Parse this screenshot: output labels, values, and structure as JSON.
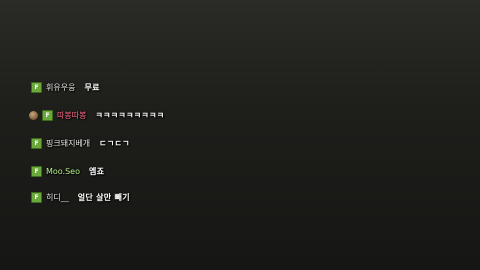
{
  "chat": {
    "messages": [
      {
        "badge": "F",
        "username": "휘유우웅",
        "text": "무료"
      },
      {
        "badge": "F",
        "has_avatar": true,
        "username": "따봉따봉",
        "text": "ㅋㅋㅋㅋㅋㅋㅋㅋㅋ"
      },
      {
        "badge": "F",
        "username": "핑크돼지베개",
        "text": "ㄷㄱㄷㄱ"
      },
      {
        "badge": "F",
        "username": "Moo.Seo",
        "text": "엠죠"
      },
      {
        "badge": "F",
        "username": "히디__",
        "text": "얼단 살만 빼기"
      }
    ]
  },
  "colors": {
    "badge": "#6aaa3a",
    "username_default": "#e6e6e6",
    "username_pink": "#ff6b8a",
    "username_green": "#b6f08a",
    "message_text": "#ffffff",
    "background": "#1e1e1b"
  }
}
